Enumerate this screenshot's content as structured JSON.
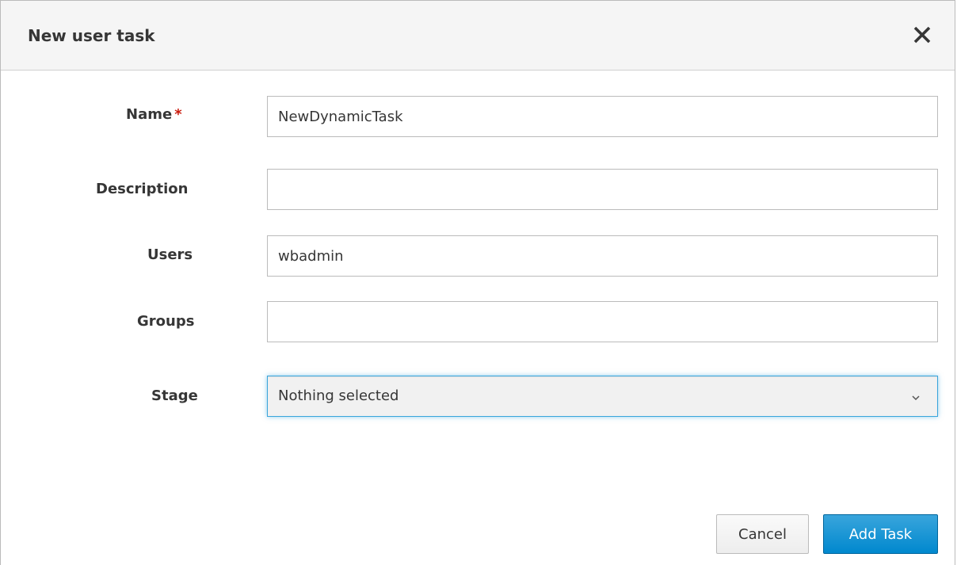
{
  "dialog": {
    "title": "New user task",
    "close_icon": "close-icon"
  },
  "form": {
    "name": {
      "label": "Name",
      "required_marker": "*",
      "value": "NewDynamicTask"
    },
    "description": {
      "label": "Description",
      "value": ""
    },
    "users": {
      "label": "Users",
      "value": "wbadmin"
    },
    "groups": {
      "label": "Groups",
      "value": ""
    },
    "stage": {
      "label": "Stage",
      "selected": "Nothing selected",
      "icon": "chevron-down-icon"
    }
  },
  "actions": {
    "cancel_label": "Cancel",
    "add_label": "Add Task"
  },
  "colors": {
    "primary": "#0088ce",
    "focus_border": "#39a5dc",
    "required": "#c9190b",
    "header_bg": "#f5f5f5"
  }
}
